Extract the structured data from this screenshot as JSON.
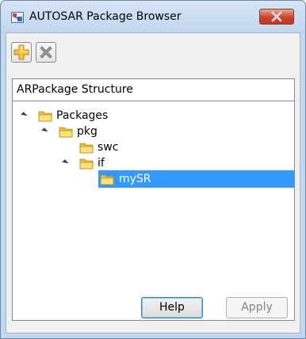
{
  "window": {
    "title": "AUTOSAR Package Browser",
    "close_icon": "close-icon",
    "app_icon": "autosar-app-icon"
  },
  "toolbar": {
    "add_icon": "add-plus-icon",
    "delete_icon": "delete-x-icon",
    "delete_enabled": false
  },
  "tree": {
    "header": "ARPackage Structure",
    "nodes": [
      {
        "label": "Packages",
        "level": 0,
        "expanded": true,
        "selected": false
      },
      {
        "label": "pkg",
        "level": 1,
        "expanded": true,
        "selected": false
      },
      {
        "label": "swc",
        "level": 2,
        "expanded": false,
        "selected": false
      },
      {
        "label": "if",
        "level": 2,
        "expanded": true,
        "selected": false
      },
      {
        "label": "mySR",
        "level": 3,
        "expanded": false,
        "selected": true
      }
    ]
  },
  "buttons": {
    "help_label": "Help",
    "apply_label": "Apply",
    "apply_enabled": false
  },
  "colors": {
    "selection": "#3399ff",
    "title_bar": "#c3d7ee",
    "close_red": "#c9432d"
  }
}
